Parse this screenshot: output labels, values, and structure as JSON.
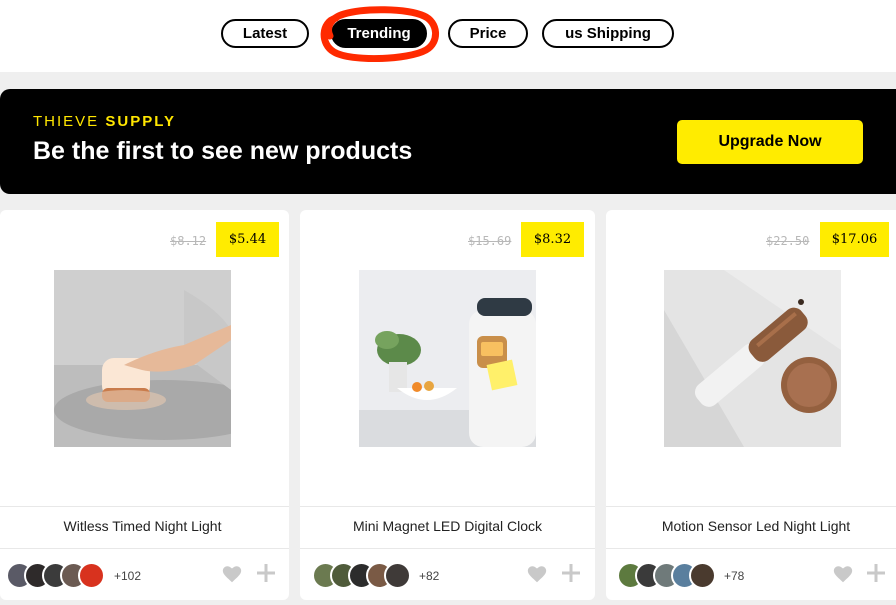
{
  "tabs": [
    {
      "label": "Latest"
    },
    {
      "label": "Trending"
    },
    {
      "label": "Price"
    },
    {
      "label": "us Shipping"
    }
  ],
  "banner": {
    "brand_part1": "THIEVE",
    "brand_part2": "SUPPLY",
    "headline": "Be the first to see new products",
    "cta_label": "Upgrade Now"
  },
  "colors": {
    "accent_yellow": "#ffec00",
    "banner_bg": "#000000",
    "annotation_red": "#ff2a00"
  },
  "products": [
    {
      "name": "Witless Timed Night Light",
      "old_price": "$8.12",
      "price": "$5.44",
      "likes_extra": "+102"
    },
    {
      "name": "Mini Magnet LED Digital Clock",
      "old_price": "$15.69",
      "price": "$8.32",
      "likes_extra": "+82"
    },
    {
      "name": "Motion Sensor Led Night Light",
      "old_price": "$22.50",
      "price": "$17.06",
      "likes_extra": "+78"
    }
  ],
  "icons": {
    "like": "heart-icon",
    "add": "plus-icon"
  }
}
